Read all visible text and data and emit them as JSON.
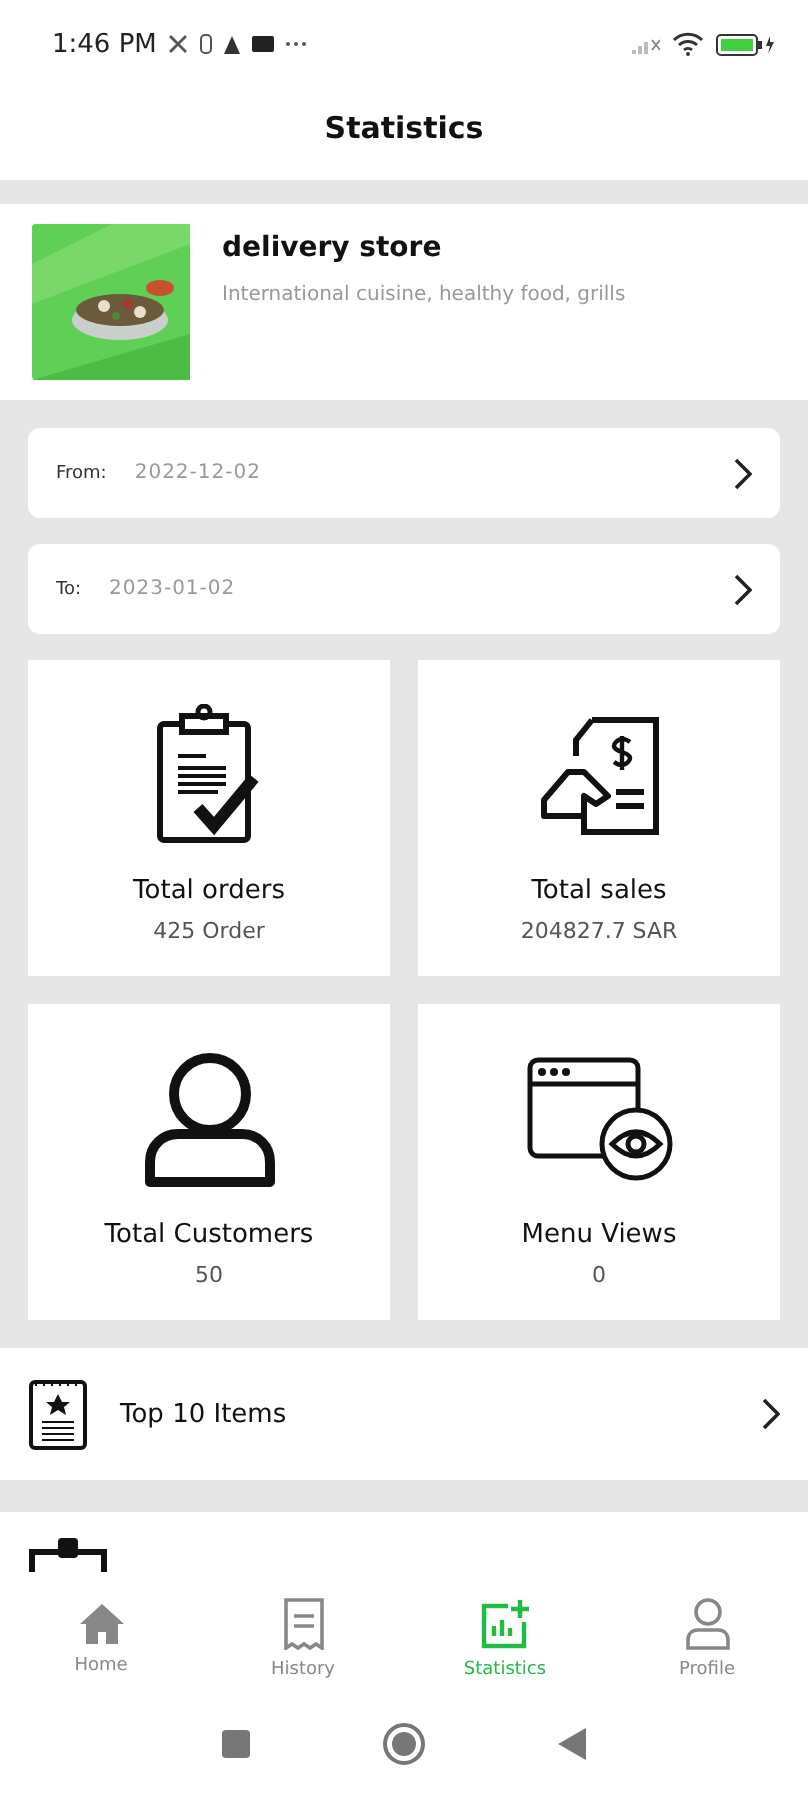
{
  "status_bar": {
    "time": "1:46 PM"
  },
  "header": {
    "title": "Statistics"
  },
  "store": {
    "name": "delivery store",
    "description": "International cuisine, healthy food, grills"
  },
  "date_filters": [
    {
      "label": "From:",
      "value": "2022-12-02"
    },
    {
      "label": "To:",
      "value": "2023-01-02"
    }
  ],
  "stats": [
    {
      "kind": "orders",
      "label": "Total orders",
      "value": "425 Order"
    },
    {
      "kind": "sales",
      "label": "Total sales",
      "value": "204827.7 SAR"
    },
    {
      "kind": "customers",
      "label": "Total Customers",
      "value": "50"
    },
    {
      "kind": "views",
      "label": "Menu Views",
      "value": "0"
    }
  ],
  "links": [
    {
      "label": "Top 10 Items"
    }
  ],
  "bottom_nav": [
    {
      "kind": "home",
      "label": "Home",
      "selected": false
    },
    {
      "kind": "history",
      "label": "History",
      "selected": false
    },
    {
      "kind": "statistics",
      "label": "Statistics",
      "selected": true
    },
    {
      "kind": "profile",
      "label": "Profile",
      "selected": false
    }
  ]
}
